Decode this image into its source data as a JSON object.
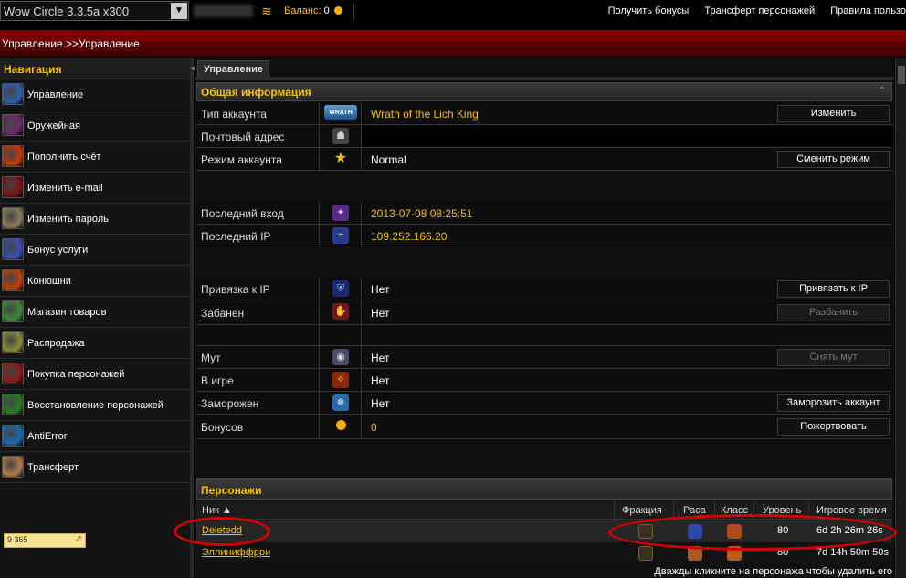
{
  "topbar": {
    "realm_value": "Wow Circle 3.3.5a x300",
    "balance_label": "Баланс:",
    "balance_value": "0",
    "links": [
      "Получить бонусы",
      "Трансферт персонажей",
      "Правила пользо"
    ]
  },
  "breadcrumb": "Управление >>Управление",
  "sidebar": {
    "title": "Навигация",
    "items": [
      {
        "label": "Управление",
        "icon": "shield-icon",
        "color": "#2f5fa8"
      },
      {
        "label": "Оружейная",
        "icon": "crossed-swords-icon",
        "color": "#6a2b6a"
      },
      {
        "label": "Пополнить счёт",
        "icon": "fire-icon",
        "color": "#c23a0a"
      },
      {
        "label": "Изменить e-mail",
        "icon": "mail-icon",
        "color": "#7a1212"
      },
      {
        "label": "Изменить пароль",
        "icon": "mask-icon",
        "color": "#8c7a5a"
      },
      {
        "label": "Бонус услуги",
        "icon": "sword-icon",
        "color": "#3a4fb0"
      },
      {
        "label": "Конюшни",
        "icon": "horse-icon",
        "color": "#c0400a"
      },
      {
        "label": "Магазин товаров",
        "icon": "orb-icon",
        "color": "#3a8a3a"
      },
      {
        "label": "Распродажа",
        "icon": "hands-icon",
        "color": "#8a8a3a"
      },
      {
        "label": "Покупка персонажей",
        "icon": "demon-icon",
        "color": "#8a1a1a"
      },
      {
        "label": "Восстановление персонажей",
        "icon": "tree-icon",
        "color": "#2a7a2a"
      },
      {
        "label": "AntiError",
        "icon": "swirl-icon",
        "color": "#1a6ab0"
      },
      {
        "label": "Трансферт",
        "icon": "face-icon",
        "color": "#b07a4a"
      }
    ],
    "badge": "9 365"
  },
  "main": {
    "tab": "Управление",
    "general_title": "Общая информация",
    "account_type_label": "Тип аккаунта",
    "account_type_value": "Wrath of the Lich King",
    "account_type_badge": "WRATH",
    "email_label": "Почтовый адрес",
    "mode_label": "Режим аккаунта",
    "mode_value": "Normal",
    "change_button": "Изменить",
    "change_mode_button": "Сменить режим",
    "last_login_label": "Последний вход",
    "last_login_value": "2013-07-08 08:25:51",
    "last_ip_label": "Последний IP",
    "last_ip_value": "109.252.166.20",
    "ip_bind_label": "Привязка к IP",
    "ip_bind_value": "Нет",
    "ip_bind_button": "Привязать к IP",
    "banned_label": "Забанен",
    "banned_value": "Нет",
    "unban_button": "Разбанить",
    "mute_label": "Мут",
    "mute_value": "Нет",
    "unmute_button": "Снять мут",
    "ingame_label": "В игре",
    "ingame_value": "Нет",
    "frozen_label": "Заморожен",
    "frozen_value": "Нет",
    "freeze_button": "Заморозить аккаунт",
    "bonus_label": "Бонусов",
    "bonus_value": "0",
    "donate_button": "Пожертвовать"
  },
  "characters": {
    "title": "Персонажи",
    "columns": [
      "Ник ▲",
      "Фракция",
      "Раса",
      "Класс",
      "Уровень",
      "Игровое время"
    ],
    "rows": [
      {
        "nick": "Deletedd",
        "level": "80",
        "time": "6d 2h 26m 26s"
      },
      {
        "nick": "Эллиниффрри",
        "level": "80",
        "time": "7d 14h 50m 50s"
      }
    ],
    "hint": "Дважды кликните на персонажа чтобы удалить его"
  },
  "colors": {
    "accent": "#f4c300",
    "header_red": "#8a0000",
    "annotation": "#d40000"
  }
}
